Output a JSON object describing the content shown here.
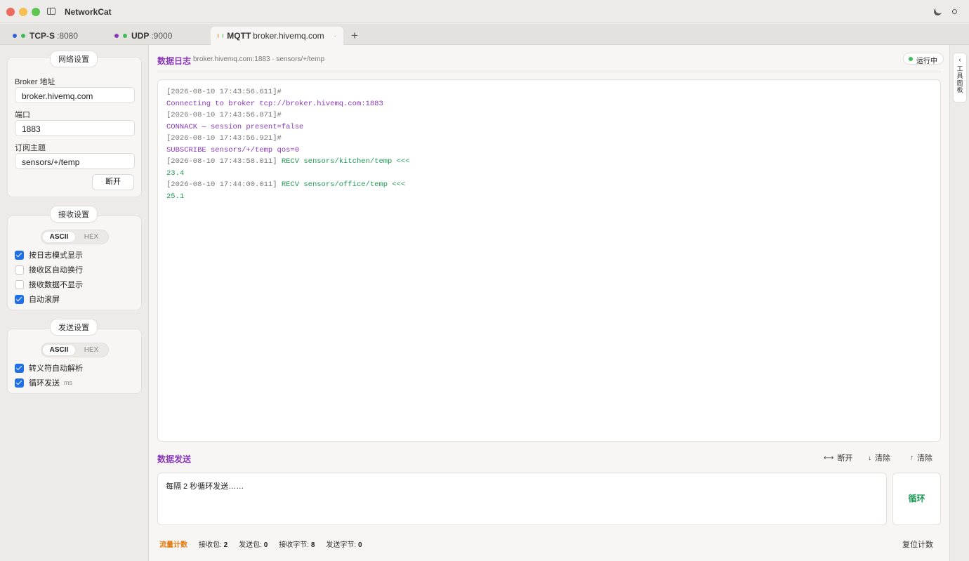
{
  "window": {
    "title": "NetworkCat"
  },
  "tabs": [
    {
      "label": "TCP-S",
      "detail": ":8080",
      "color": "#3a64d8"
    },
    {
      "label": "UDP",
      "detail": ":9000",
      "color": "#8a3ab9"
    },
    {
      "label": "MQTT",
      "detail": "broker.hivemq.com",
      "color": "#e07a10",
      "status_color": "#3dbd55",
      "close": "·"
    }
  ],
  "network": {
    "section_label": "网络设置",
    "broker_label": "Broker 地址",
    "broker_value": "broker.hivemq.com",
    "port_label": "端口",
    "port_value": "1883",
    "topic_label": "订阅主题",
    "topic_value": "sensors/+/temp",
    "disconnect_button": "断开"
  },
  "receive": {
    "section_label": "接收设置",
    "mode_ascii": "ASCII",
    "mode_hex": "HEX",
    "options": [
      {
        "label": "按日志模式显示",
        "checked": true
      },
      {
        "label": "接收区自动换行",
        "checked": false
      },
      {
        "label": "接收数据不显示",
        "checked": false
      },
      {
        "label": "自动滚屏",
        "checked": true
      }
    ]
  },
  "send_settings": {
    "section_label": "发送设置",
    "mode_ascii": "ASCII",
    "mode_hex": "HEX",
    "options": [
      {
        "label": "转义符自动解析",
        "checked": true
      },
      {
        "label": "循环发送",
        "checked": true,
        "unit": "ms"
      }
    ]
  },
  "log": {
    "title": "数据日志",
    "subtitle": "broker.hivemq.com:1883 · sensors/+/temp",
    "status": "运行中",
    "lines": [
      {
        "ts": "[2026-08-10 17:43:56.611]#",
        "msg": ""
      },
      {
        "ts": "",
        "msg": "Connecting to broker tcp://broker.hivemq.com:1883"
      },
      {
        "ts": "[2026-08-10 17:43:56.871]#",
        "msg": ""
      },
      {
        "ts": "",
        "msg": "CONNACK — session present=false"
      },
      {
        "ts": "[2026-08-10 17:43:56.921]#",
        "msg": ""
      },
      {
        "ts": "",
        "msg": "SUBSCRIBE sensors/+/temp qos=0"
      },
      {
        "ts": "[2026-08-10 17:43:58.011]",
        "msg": " RECV sensors/kitchen/temp <<<"
      },
      {
        "ts": "",
        "msg": "23.4"
      },
      {
        "ts": "[2026-08-10 17:44:00.011]",
        "msg": " RECV sensors/office/temp <<<"
      },
      {
        "ts": "",
        "msg": "25.1"
      }
    ]
  },
  "send": {
    "title": "数据发送",
    "disconnect": "断开",
    "clear_recv": "清除",
    "clear_send": "清除",
    "content": "每隔  2  秒循环发送……",
    "loop_button": "循环"
  },
  "stats": {
    "title": "流量计数",
    "recv_packets_label": "接收包:",
    "recv_packets": "2",
    "send_packets_label": "发送包:",
    "send_packets": "0",
    "recv_bytes_label": "接收字节:",
    "recv_bytes": "8",
    "send_bytes_label": "发送字节:",
    "send_bytes": "0",
    "reset_button": "复位计数"
  },
  "tool_panel": {
    "label": "工具面板"
  }
}
